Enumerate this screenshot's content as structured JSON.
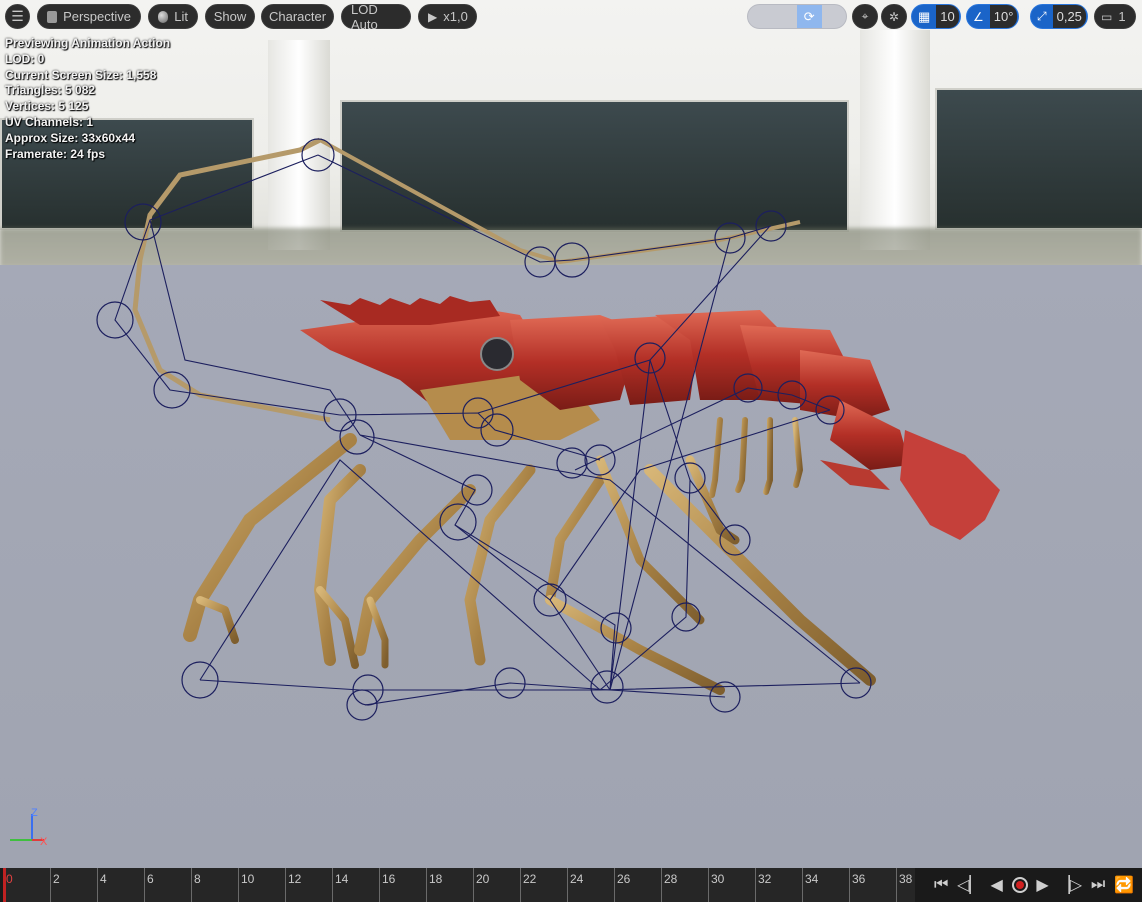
{
  "toolbar": {
    "menu_icon": "hamburger-icon",
    "perspective_label": "Perspective",
    "lit_label": "Lit",
    "show_label": "Show",
    "character_label": "Character",
    "lod_label": "LOD Auto",
    "playspeed_label": "x1,0",
    "grid_snap_value": "10",
    "rotation_snap_value": "10°",
    "scale_snap_value": "0,25",
    "camera_speed_value": "1"
  },
  "stats": {
    "line1": "Previewing Animation Action",
    "line2": "LOD: 0",
    "line3": "Current Screen Size: 1,558",
    "line4": "Triangles: 5 082",
    "line5": "Vertices: 5 125",
    "line6": "UV Channels: 1",
    "line7": "Approx Size: 33x60x44",
    "line8": "Framerate: 24 fps"
  },
  "axis": {
    "z": "Z",
    "x": "X"
  },
  "timeline": {
    "ticks": [
      "0",
      "2",
      "4",
      "6",
      "8",
      "10",
      "12",
      "14",
      "16",
      "18",
      "20",
      "22",
      "24",
      "26",
      "28",
      "30",
      "32",
      "34",
      "36",
      "38"
    ],
    "current_frame": 0
  },
  "colors": {
    "accent": "#1a64c8",
    "playhead": "#c12222",
    "bones": "#1c1f5e",
    "shell": "#b8362a",
    "legs": "#b08a4a"
  }
}
